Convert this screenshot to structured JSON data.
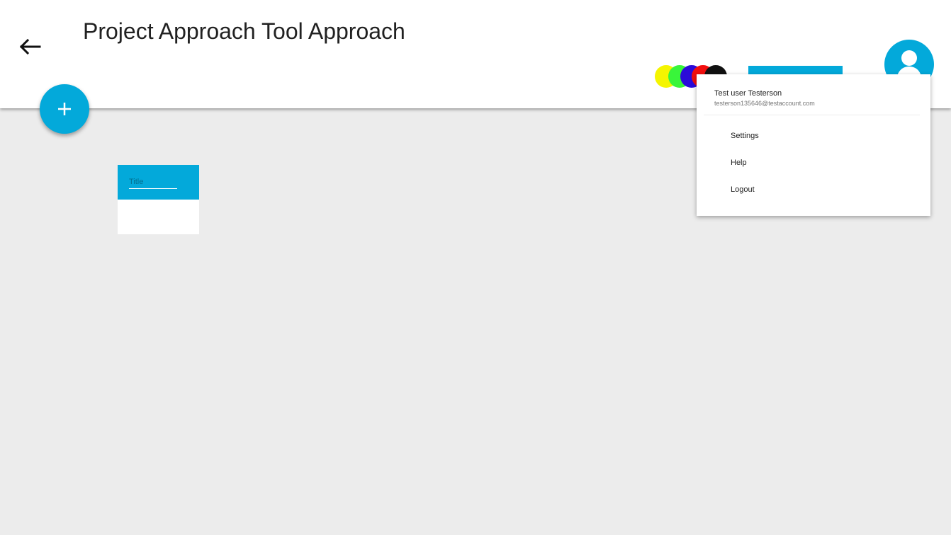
{
  "header": {
    "title": "Project Approach Tool Approach",
    "back_icon": "arrow-left-icon"
  },
  "color_palette": [
    "#f5f500",
    "#39f53a",
    "#2b0bd9",
    "#f20e0e",
    "#111111"
  ],
  "accent_color": "#03a9da",
  "fab": {
    "icon": "plus-icon"
  },
  "card": {
    "title_placeholder": "Title",
    "title_value": ""
  },
  "user_menu": {
    "name": "Test user Testerson",
    "email": "testerson135646@testaccount.com",
    "items": [
      {
        "label": "Settings"
      },
      {
        "label": "Help"
      },
      {
        "label": "Logout"
      }
    ]
  },
  "avatar": {
    "icon": "user-icon"
  }
}
